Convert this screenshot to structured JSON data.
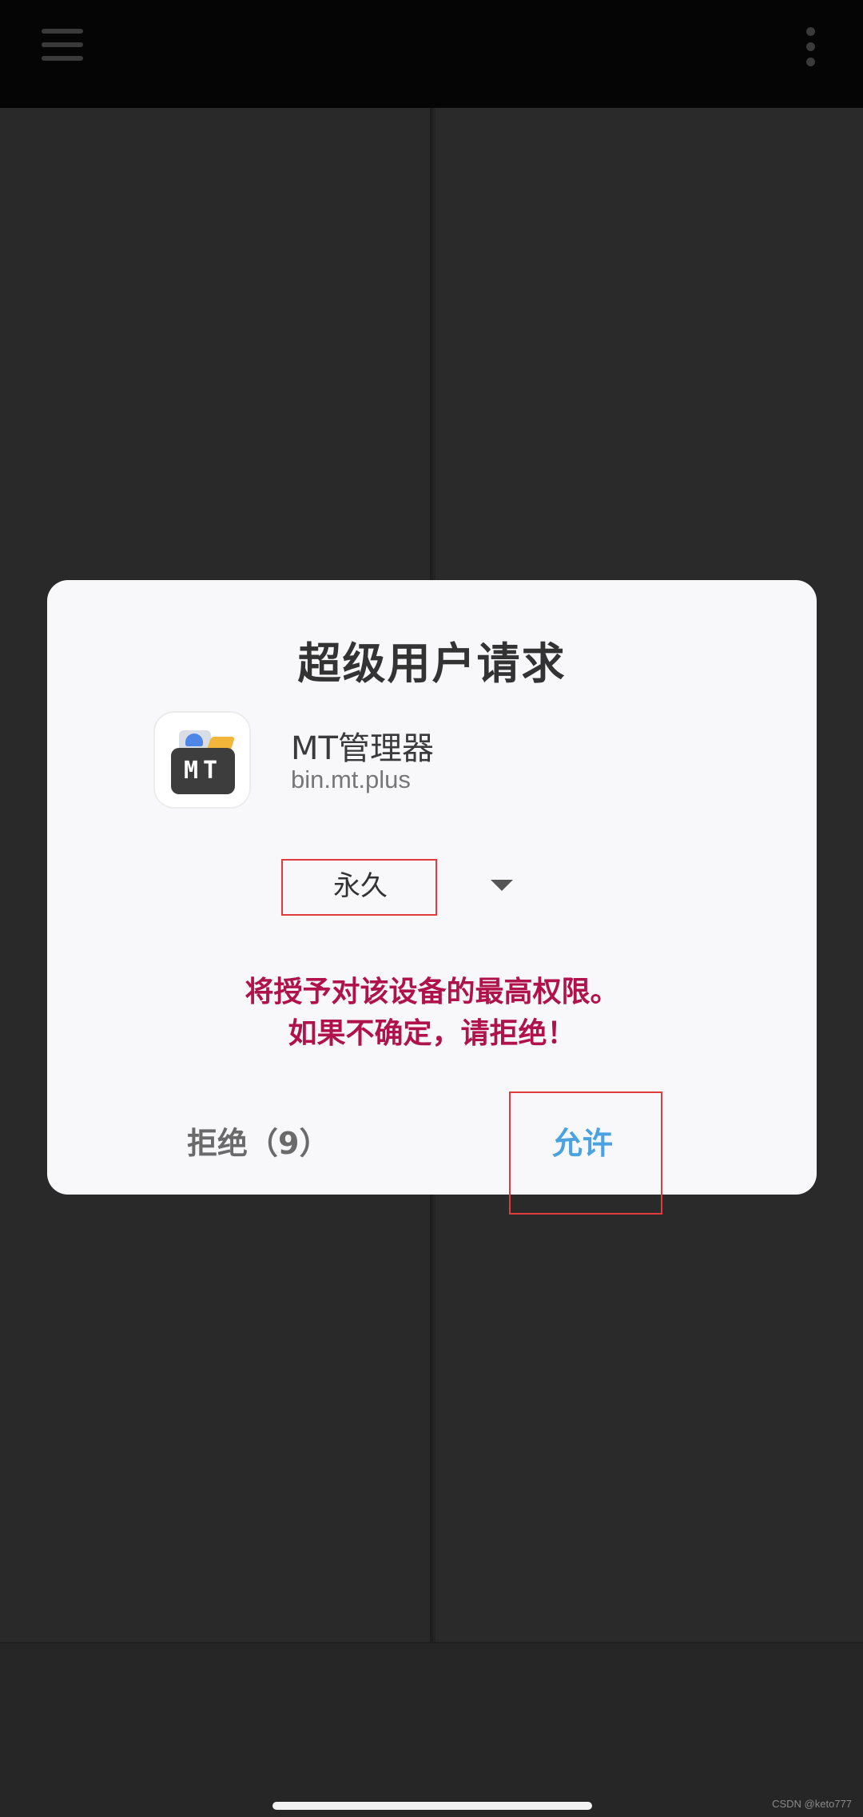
{
  "dialog": {
    "title": "超级用户请求",
    "app_name": "MT管理器",
    "app_package": "bin.mt.plus",
    "app_icon_text": "MT",
    "duration_selected": "永久",
    "warning_line1": "将授予对该设备的最高权限。",
    "warning_line2": "如果不确定，请拒绝！",
    "deny_label": "拒绝（9）",
    "allow_label": "允许"
  },
  "watermark": "CSDN @keto777",
  "colors": {
    "accent": "#4aa3e0",
    "warning": "#b0134b",
    "annotation": "#e13c3c"
  }
}
